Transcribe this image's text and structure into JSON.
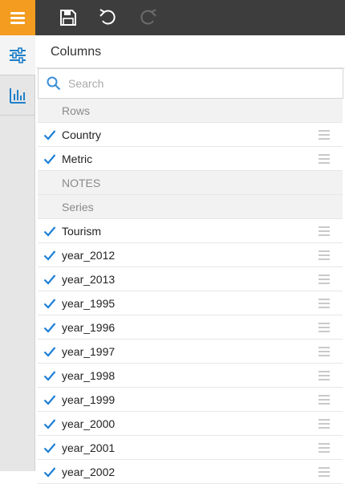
{
  "toolbar": {
    "menu_icon": "hamburger-icon",
    "save_icon": "save-icon",
    "undo_icon": "undo-icon",
    "redo_icon": "redo-icon"
  },
  "sidebar": {
    "items": [
      {
        "icon": "sliders-icon",
        "active": true
      },
      {
        "icon": "bar-chart-icon",
        "active": false
      }
    ]
  },
  "panel": {
    "title": "Columns",
    "search_placeholder": "Search"
  },
  "rows": [
    {
      "label": "Rows",
      "type": "group"
    },
    {
      "label": "Country",
      "type": "item",
      "checked": true
    },
    {
      "label": "Metric",
      "type": "item",
      "checked": true
    },
    {
      "label": "NOTES",
      "type": "group"
    },
    {
      "label": "Series",
      "type": "group"
    },
    {
      "label": "Tourism",
      "type": "item",
      "checked": true
    },
    {
      "label": "year_2012",
      "type": "item",
      "checked": true
    },
    {
      "label": "year_2013",
      "type": "item",
      "checked": true
    },
    {
      "label": "year_1995",
      "type": "item",
      "checked": true
    },
    {
      "label": "year_1996",
      "type": "item",
      "checked": true
    },
    {
      "label": "year_1997",
      "type": "item",
      "checked": true
    },
    {
      "label": "year_1998",
      "type": "item",
      "checked": true
    },
    {
      "label": "year_1999",
      "type": "item",
      "checked": true
    },
    {
      "label": "year_2000",
      "type": "item",
      "checked": true
    },
    {
      "label": "year_2001",
      "type": "item",
      "checked": true
    },
    {
      "label": "year_2002",
      "type": "item",
      "checked": true
    }
  ],
  "colors": {
    "accent": "#f39c1f",
    "check": "#1e7fd6",
    "icon_blue": "#1f7fc8"
  }
}
